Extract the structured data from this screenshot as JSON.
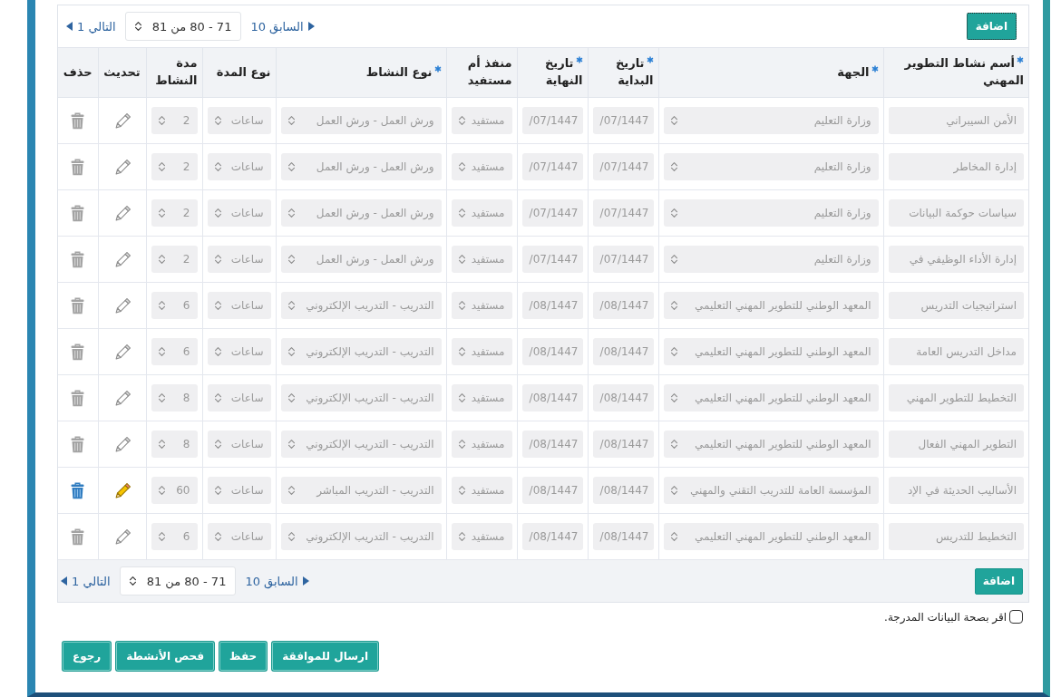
{
  "toolbar": {
    "add_button": {
      "label": "اضافة",
      "focused": true
    },
    "pagination": {
      "previous": "السابق 10",
      "range": "71 - 80 من 81",
      "next": "التالي 1"
    }
  },
  "table": {
    "columns": [
      {
        "label": "أسم نشاط التطوير المهني",
        "required": true
      },
      {
        "label": "الجهة",
        "required": true
      },
      {
        "label": "تاريخ البداية",
        "required": true
      },
      {
        "label": "تاريخ النهاية",
        "required": true
      },
      {
        "label": "منفذ أم مستفيد",
        "required": false
      },
      {
        "label": "نوع النشاط",
        "required": true
      },
      {
        "label": "نوع المدة",
        "required": false
      },
      {
        "label": "مدة النشاط",
        "required": false
      },
      {
        "label": "تحديث",
        "required": false
      },
      {
        "label": "حذف",
        "required": false
      }
    ],
    "rows": [
      {
        "name": "الأمن السيبراني",
        "entity": "وزارة التعليم",
        "start_date": "/07/1447",
        "end_date": "/07/1447",
        "provider_or_beneficiary": "مستفيد",
        "activity_type": "ورش العمل - ورش العمل",
        "duration_type": "ساعات",
        "duration": "2",
        "active": false
      },
      {
        "name": "إدارة المخاطر",
        "entity": "وزارة التعليم",
        "start_date": "/07/1447",
        "end_date": "/07/1447",
        "provider_or_beneficiary": "مستفيد",
        "activity_type": "ورش العمل - ورش العمل",
        "duration_type": "ساعات",
        "duration": "2",
        "active": false
      },
      {
        "name": "سياسات حوكمة البيانات",
        "entity": "وزارة التعليم",
        "start_date": "/07/1447",
        "end_date": "/07/1447",
        "provider_or_beneficiary": "مستفيد",
        "activity_type": "ورش العمل - ورش العمل",
        "duration_type": "ساعات",
        "duration": "2",
        "active": false
      },
      {
        "name": "إدارة الأداء الوظيفي في",
        "entity": "وزارة التعليم",
        "start_date": "/07/1447",
        "end_date": "/07/1447",
        "provider_or_beneficiary": "مستفيد",
        "activity_type": "ورش العمل - ورش العمل",
        "duration_type": "ساعات",
        "duration": "2",
        "active": false
      },
      {
        "name": "استراتيجيات التدريس",
        "entity": "المعهد الوطني للتطوير المهني التعليمي",
        "start_date": "/08/1447",
        "end_date": "/08/1447",
        "provider_or_beneficiary": "مستفيد",
        "activity_type": "التدريب - التدريب الإلكتروني",
        "duration_type": "ساعات",
        "duration": "6",
        "active": false
      },
      {
        "name": "مداخل التدريس العامة",
        "entity": "المعهد الوطني للتطوير المهني التعليمي",
        "start_date": "/08/1447",
        "end_date": "/08/1447",
        "provider_or_beneficiary": "مستفيد",
        "activity_type": "التدريب - التدريب الإلكتروني",
        "duration_type": "ساعات",
        "duration": "6",
        "active": false
      },
      {
        "name": "التخطيط للتطوير المهني",
        "entity": "المعهد الوطني للتطوير المهني التعليمي",
        "start_date": "/08/1447",
        "end_date": "/08/1447",
        "provider_or_beneficiary": "مستفيد",
        "activity_type": "التدريب - التدريب الإلكتروني",
        "duration_type": "ساعات",
        "duration": "8",
        "active": false
      },
      {
        "name": "التطوير المهني الفعال",
        "entity": "المعهد الوطني للتطوير المهني التعليمي",
        "start_date": "/08/1447",
        "end_date": "/08/1447",
        "provider_or_beneficiary": "مستفيد",
        "activity_type": "التدريب - التدريب الإلكتروني",
        "duration_type": "ساعات",
        "duration": "8",
        "active": false
      },
      {
        "name": "الأساليب الحديثة في الإد",
        "entity": "المؤسسة العامة للتدريب التقني والمهني",
        "start_date": "/08/1447",
        "end_date": "/08/1447",
        "provider_or_beneficiary": "مستفيد",
        "activity_type": "التدريب - التدريب المباشر",
        "duration_type": "ساعات",
        "duration": "60",
        "active": true
      },
      {
        "name": "التخطيط للتدريس",
        "entity": "المعهد الوطني للتطوير المهني التعليمي",
        "start_date": "/08/1447",
        "end_date": "/08/1447",
        "provider_or_beneficiary": "مستفيد",
        "activity_type": "التدريب - التدريب الإلكتروني",
        "duration_type": "ساعات",
        "duration": "6",
        "active": false
      }
    ]
  },
  "footer": {
    "add_button": {
      "label": "اضافة",
      "focused": false
    },
    "pagination": {
      "previous": "السابق 10",
      "range": "71 - 80 من 81",
      "next": "التالي 1"
    }
  },
  "confirmation": {
    "label": "اقر بصحة البيانات المدرجة.",
    "checked": false
  },
  "actions": [
    {
      "label": "ارسال للموافقة"
    },
    {
      "label": "حفظ"
    },
    {
      "label": "فحص الأنشطة"
    },
    {
      "label": "رجوع"
    }
  ]
}
